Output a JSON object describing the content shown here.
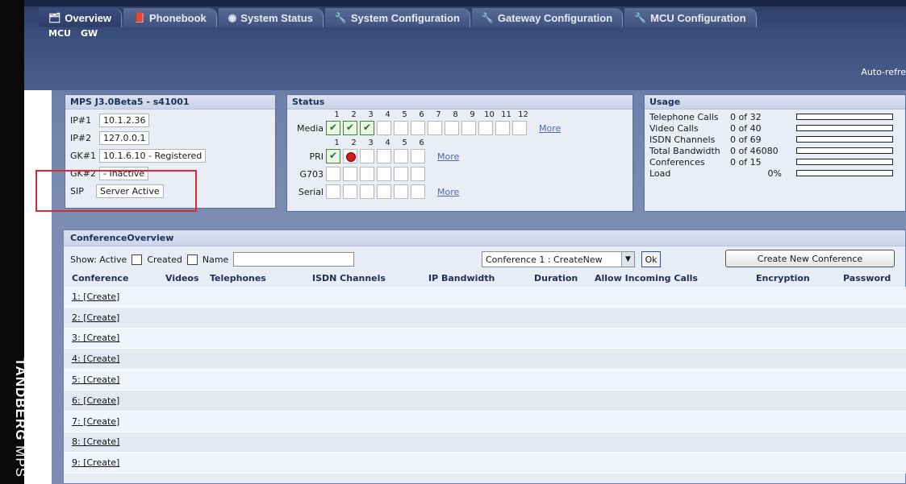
{
  "brand": {
    "name": "TANDBERG",
    "product": "MPS"
  },
  "tabs": [
    {
      "icon": "overview-icon",
      "glyph": "🗂",
      "label": "Overview",
      "active": true
    },
    {
      "icon": "phonebook-icon",
      "glyph": "📕",
      "label": "Phonebook",
      "active": false
    },
    {
      "icon": "system-status-icon",
      "glyph": "◉",
      "label": "System Status",
      "active": false
    },
    {
      "icon": "wrench-icon",
      "glyph": "🔧",
      "label": "System Configuration",
      "active": false
    },
    {
      "icon": "wrench-icon",
      "glyph": "🔧",
      "label": "Gateway Configuration",
      "active": false
    },
    {
      "icon": "wrench-icon",
      "glyph": "🔧",
      "label": "MCU Configuration",
      "active": false
    }
  ],
  "subnav": [
    "MCU",
    "GW"
  ],
  "autorefresh": "Auto-refre",
  "mps": {
    "title": "MPS J3.0Beta5 - s41001",
    "rows": [
      {
        "key": "IP#1",
        "value": "10.1.2.36"
      },
      {
        "key": "IP#2",
        "value": "127.0.0.1"
      },
      {
        "key": "GK#1",
        "value": "10.1.6.10 - Registered"
      },
      {
        "key": "GK#2",
        "value": "- Inactive"
      },
      {
        "key": "SIP",
        "value": "Server Active"
      }
    ]
  },
  "status": {
    "title": "Status",
    "media_numbers": [
      "1",
      "2",
      "3",
      "4",
      "5",
      "6",
      "7",
      "8",
      "9",
      "10",
      "11",
      "12"
    ],
    "pri_numbers": [
      "1",
      "2",
      "3",
      "4",
      "5",
      "6"
    ],
    "media_label": "Media",
    "pri_label": "PRI",
    "g703_label": "G703",
    "serial_label": "Serial",
    "more": "More",
    "media_states": [
      "ok",
      "ok",
      "ok",
      "",
      "",
      "",
      "",
      "",
      "",
      "",
      "",
      ""
    ],
    "pri_states": [
      "ok",
      "err",
      "",
      "",
      "",
      ""
    ],
    "g703_states": [
      "",
      "",
      "",
      "",
      "",
      ""
    ],
    "serial_states": [
      "",
      "",
      "",
      "",
      "",
      ""
    ]
  },
  "usage": {
    "title": "Usage",
    "rows": [
      {
        "name": "Telephone Calls",
        "count": "0 of 32",
        "level": 0
      },
      {
        "name": "Video Calls",
        "count": "0 of 40",
        "level": 0
      },
      {
        "name": "ISDN Channels",
        "count": "0 of 69",
        "level": 0
      },
      {
        "name": "Total Bandwidth",
        "count": "0 of 46080",
        "level": 0
      },
      {
        "name": "Conferences",
        "count": "0 of 15",
        "level": 0
      },
      {
        "name": "Load",
        "count": "0%",
        "level": 0
      }
    ]
  },
  "conference": {
    "title": "ConferenceOverview",
    "show_label": "Show: Active",
    "created_label": "Created",
    "name_label": "Name",
    "select_value": "Conference 1 : CreateNew",
    "ok_label": "Ok",
    "create_button": "Create New Conference",
    "columns": [
      "Conference",
      "Videos",
      "Telephones",
      "ISDN Channels",
      "IP Bandwidth",
      "Duration",
      "Allow Incoming Calls",
      "Encryption",
      "Password"
    ],
    "rows": [
      "1: [Create]",
      "2: [Create]",
      "3: [Create]",
      "4: [Create]",
      "5: [Create]",
      "6: [Create]",
      "7: [Create]",
      "8: [Create]",
      "9: [Create]"
    ]
  }
}
